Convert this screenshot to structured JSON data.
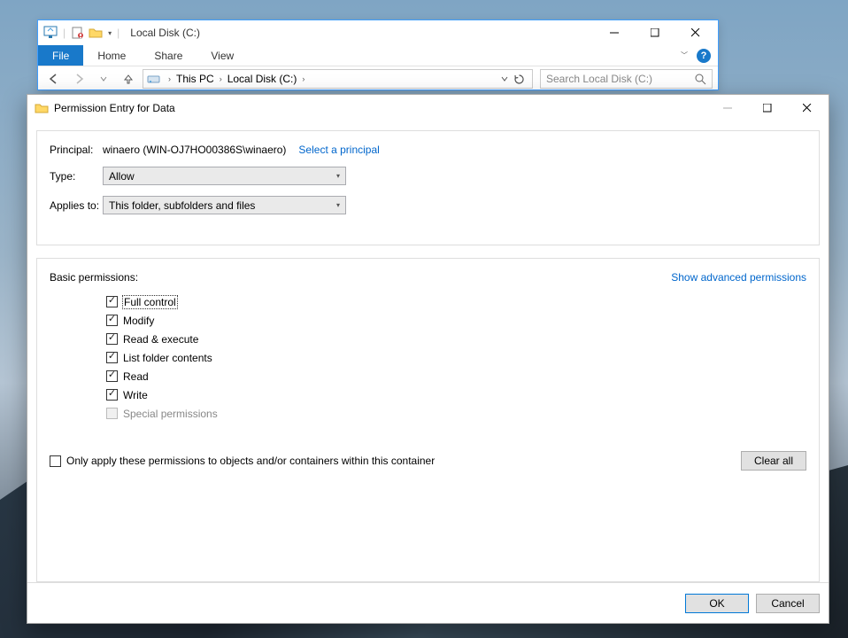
{
  "explorer": {
    "title": "Local Disk (C:)",
    "tabs": {
      "file": "File",
      "home": "Home",
      "share": "Share",
      "view": "View"
    },
    "breadcrumb": {
      "item1": "This PC",
      "item2": "Local Disk (C:)"
    },
    "search_placeholder": "Search Local Disk (C:)"
  },
  "dialog": {
    "title": "Permission Entry for Data",
    "principal_label": "Principal:",
    "principal_value": "winaero (WIN-OJ7HO00386S\\winaero)",
    "select_principal": "Select a principal",
    "type_label": "Type:",
    "type_value": "Allow",
    "applies_label": "Applies to:",
    "applies_value": "This folder, subfolders and files",
    "basic_permissions": "Basic permissions:",
    "show_advanced": "Show advanced permissions",
    "perms": {
      "full_control": "Full control",
      "modify": "Modify",
      "read_execute": "Read & execute",
      "list_folder": "List folder contents",
      "read": "Read",
      "write": "Write",
      "special": "Special permissions"
    },
    "only_apply": "Only apply these permissions to objects and/or containers within this container",
    "clear_all": "Clear all",
    "ok": "OK",
    "cancel": "Cancel"
  }
}
